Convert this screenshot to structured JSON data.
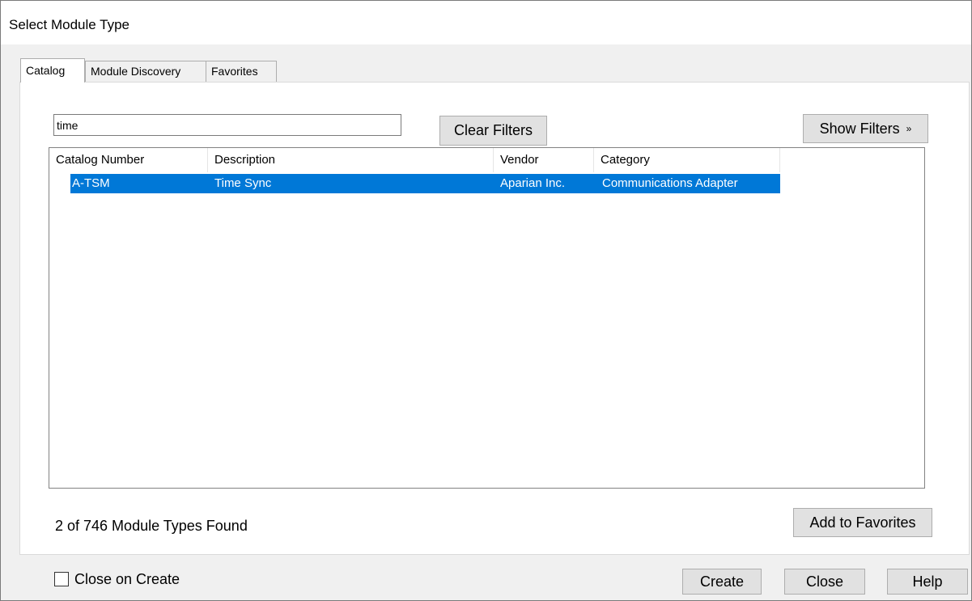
{
  "window": {
    "title": "Select Module Type"
  },
  "tabs": [
    {
      "label": "Catalog",
      "active": true
    },
    {
      "label": "Module Discovery",
      "active": false
    },
    {
      "label": "Favorites",
      "active": false
    }
  ],
  "search": {
    "value": "time"
  },
  "filters": {
    "clear_label": "Clear Filters",
    "show_label": "Show Filters",
    "show_icon": "double-chevron-down-icon"
  },
  "table": {
    "columns": [
      "Catalog Number",
      "Description",
      "Vendor",
      "Category"
    ],
    "rows": [
      {
        "catalog_number": "A-TSM",
        "description": "Time Sync",
        "vendor": "Aparian Inc.",
        "category": "Communications Adapter",
        "selected": true
      }
    ]
  },
  "status": {
    "found_text": "2 of 746 Module Types Found"
  },
  "buttons": {
    "add_favorites": "Add to Favorites",
    "create": "Create",
    "close": "Close",
    "help": "Help"
  },
  "close_on_create": {
    "label": "Close on Create",
    "checked": false
  },
  "colors": {
    "selection": "#0078d7",
    "background": "#f0f0f0",
    "panel": "#ffffff"
  }
}
